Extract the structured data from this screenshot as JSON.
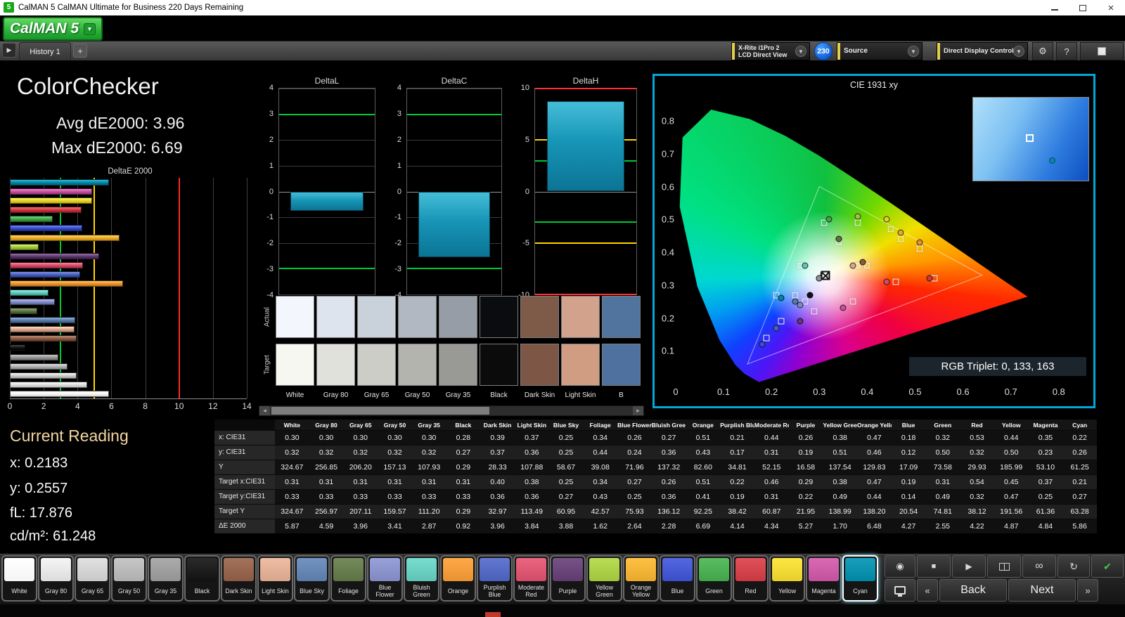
{
  "window": {
    "titlebar_icon": "5",
    "title": "CalMAN 5 CalMAN Ultimate for Business 220 Days Remaining",
    "logo_text": "CalMAN 5"
  },
  "tab_bar": {
    "tab": "History 1",
    "add_tab": "+"
  },
  "top_controls": {
    "meter_line1": "X-Rite i1Pro 2",
    "meter_line2": "LCD Direct View",
    "badge": "230",
    "source_label": "Source",
    "display_control_label": "Direct Display Control",
    "help_label": "?"
  },
  "summary": {
    "title": "ColorChecker",
    "avg_label": "Avg dE2000: 3.96",
    "max_label": "Max dE2000: 6.69"
  },
  "current_reading": {
    "title": "Current Reading",
    "x": "x: 0.2183",
    "y": "y: 0.2557",
    "fl": "fL: 17.876",
    "cd": "cd/m²: 61.248"
  },
  "cie_panel": {
    "title": "CIE 1931 xy",
    "rgb_triplet": "RGB Triplet: 0, 133, 163"
  },
  "swatch_compare": {
    "row_labels": [
      "Actual",
      "Target"
    ],
    "labels": [
      "White",
      "Gray 80",
      "Gray 65",
      "Gray 50",
      "Gray 35",
      "Black",
      "Dark Skin",
      "Light Skin",
      "B"
    ],
    "actual_colors": [
      "#f3f7fd",
      "#dde4ee",
      "#c9d1db",
      "#b1b8c1",
      "#979da7",
      "#0b0c10",
      "#7e5a49",
      "#d3a28c",
      "#51749f"
    ],
    "target_colors": [
      "#f7f7f2",
      "#e1e1dc",
      "#cdcdc8",
      "#b4b4af",
      "#999995",
      "#0b0b0b",
      "#7d5646",
      "#d09d83",
      "#4e71a0"
    ]
  },
  "patch_buttons": {
    "selected": "Cyan"
  },
  "nav": {
    "back": "Back",
    "next": "Next"
  },
  "chart_data": [
    {
      "type": "bar",
      "title": "DeltaE 2000",
      "orientation": "horizontal",
      "note": "bars drawn top-to-bottom from Cyan down to White",
      "categories": [
        "White",
        "Gray 80",
        "Gray 65",
        "Gray 50",
        "Gray 35",
        "Black",
        "Dark Skin",
        "Light Skin",
        "Blue Sky",
        "Foliage",
        "Blue Flower",
        "Bluish Green",
        "Orange",
        "Purplish Blue",
        "Moderate Red",
        "Purple",
        "Yellow Green",
        "Orange Yellow",
        "Blue",
        "Green",
        "Red",
        "Yellow",
        "Magenta",
        "Cyan"
      ],
      "values": [
        5.87,
        4.59,
        3.96,
        3.41,
        2.87,
        0.92,
        3.96,
        3.84,
        3.88,
        1.62,
        2.64,
        2.28,
        6.69,
        4.14,
        4.34,
        5.27,
        1.7,
        6.48,
        4.27,
        2.55,
        4.22,
        4.87,
        4.84,
        5.86
      ],
      "bar_colors": [
        "#f5f5f5",
        "#dcdcdc",
        "#c8c8c8",
        "#aeaeae",
        "#939393",
        "#121212",
        "#8a5a42",
        "#d7a58c",
        "#5a7ba8",
        "#5d7243",
        "#8088c2",
        "#5fc3b5",
        "#e89130",
        "#4a5fb8",
        "#d24c68",
        "#5e3a6e",
        "#a0c43c",
        "#e8a82c",
        "#3a4ec8",
        "#41a449",
        "#c83840",
        "#e8ce2a",
        "#c2519c",
        "#0085a3"
      ],
      "xlim": [
        0,
        14
      ],
      "x_ticks": [
        0,
        2,
        4,
        6,
        8,
        10,
        12,
        14
      ],
      "reference_lines": [
        {
          "value": 3,
          "color": "#00c832"
        },
        {
          "value": 5,
          "color": "#ffd400"
        },
        {
          "value": 10,
          "color": "#ff2828"
        }
      ]
    },
    {
      "type": "bar",
      "title": "DeltaL",
      "values": [
        -0.74
      ],
      "ylim": [
        -4,
        4
      ],
      "y_ticks": [
        4,
        3,
        2,
        1,
        0,
        -1,
        -2,
        -3,
        -4
      ],
      "reference_lines": [
        {
          "value": 3,
          "color": "#00c832"
        },
        {
          "value": -3,
          "color": "#00c832"
        }
      ]
    },
    {
      "type": "bar",
      "title": "DeltaC",
      "values": [
        -2.54
      ],
      "ylim": [
        -4,
        4
      ],
      "y_ticks": [
        4,
        3,
        2,
        1,
        0,
        -1,
        -2,
        -3,
        -4
      ],
      "reference_lines": [
        {
          "value": 3,
          "color": "#00c832"
        },
        {
          "value": -3,
          "color": "#00c832"
        }
      ]
    },
    {
      "type": "bar",
      "title": "DeltaH",
      "values": [
        8.8
      ],
      "ylim": [
        -10,
        10
      ],
      "y_ticks": [
        10,
        5,
        0,
        -5,
        -10
      ],
      "reference_lines": [
        {
          "value": 3,
          "color": "#00c832"
        },
        {
          "value": -3,
          "color": "#00c832"
        },
        {
          "value": 5,
          "color": "#ffd400"
        },
        {
          "value": -5,
          "color": "#ffd400"
        },
        {
          "value": 10,
          "color": "#ff3030"
        },
        {
          "value": -10,
          "color": "#ff3030"
        }
      ]
    },
    {
      "type": "scatter",
      "title": "CIE 1931 xy",
      "xlim": [
        0,
        0.84
      ],
      "ylim": [
        0,
        0.86
      ],
      "x_ticks": [
        "0",
        "0.1",
        "0.2",
        "0.3",
        "0.4",
        "0.5",
        "0.6",
        "0.7",
        "0.8"
      ],
      "y_ticks": [
        "0.1",
        "0.2",
        "0.3",
        "0.4",
        "0.5",
        "0.6",
        "0.7",
        "0.8"
      ],
      "white_point": {
        "x": 0.3127,
        "y": 0.329
      },
      "gamut_triangle": [
        [
          0.64,
          0.33
        ],
        [
          0.3,
          0.6
        ],
        [
          0.15,
          0.06
        ]
      ],
      "series": [
        {
          "name": "Target",
          "marker": "square",
          "points": [
            [
              0.31,
              0.33
            ],
            [
              0.31,
              0.33
            ],
            [
              0.31,
              0.33
            ],
            [
              0.31,
              0.33
            ],
            [
              0.31,
              0.33
            ],
            [
              0.31,
              0.33
            ],
            [
              0.4,
              0.36
            ],
            [
              0.38,
              0.36
            ],
            [
              0.25,
              0.27
            ],
            [
              0.34,
              0.43
            ],
            [
              0.27,
              0.25
            ],
            [
              0.26,
              0.36
            ],
            [
              0.51,
              0.41
            ],
            [
              0.22,
              0.19
            ],
            [
              0.46,
              0.31
            ],
            [
              0.29,
              0.22
            ],
            [
              0.38,
              0.49
            ],
            [
              0.47,
              0.44
            ],
            [
              0.19,
              0.14
            ],
            [
              0.31,
              0.49
            ],
            [
              0.54,
              0.32
            ],
            [
              0.45,
              0.47
            ],
            [
              0.37,
              0.25
            ],
            [
              0.21,
              0.27
            ]
          ]
        },
        {
          "name": "Measured",
          "marker": "circle",
          "points": [
            [
              0.3,
              0.32
            ],
            [
              0.3,
              0.32
            ],
            [
              0.3,
              0.32
            ],
            [
              0.3,
              0.32
            ],
            [
              0.3,
              0.32
            ],
            [
              0.28,
              0.27
            ],
            [
              0.39,
              0.37
            ],
            [
              0.37,
              0.36
            ],
            [
              0.25,
              0.25
            ],
            [
              0.34,
              0.44
            ],
            [
              0.26,
              0.24
            ],
            [
              0.27,
              0.36
            ],
            [
              0.51,
              0.43
            ],
            [
              0.21,
              0.17
            ],
            [
              0.44,
              0.31
            ],
            [
              0.26,
              0.19
            ],
            [
              0.38,
              0.51
            ],
            [
              0.47,
              0.46
            ],
            [
              0.18,
              0.12
            ],
            [
              0.32,
              0.5
            ],
            [
              0.53,
              0.32
            ],
            [
              0.44,
              0.5
            ],
            [
              0.35,
              0.23
            ],
            [
              0.22,
              0.26
            ]
          ]
        }
      ]
    },
    {
      "type": "table",
      "headers": [
        "White",
        "Gray 80",
        "Gray 65",
        "Gray 50",
        "Gray 35",
        "Black",
        "Dark Skin",
        "Light Skin",
        "Blue Sky",
        "Foliage",
        "Blue Flower",
        "Bluish Green",
        "Orange",
        "Purplish Blue",
        "Moderate Red",
        "Purple",
        "Yellow Green",
        "Orange Yellow",
        "Blue",
        "Green",
        "Red",
        "Yellow",
        "Magenta",
        "Cyan"
      ],
      "row_labels": [
        "x: CIE31",
        "y: CIE31",
        "Y",
        "Target x:CIE31",
        "Target y:CIE31",
        "Target Y",
        "ΔE 2000"
      ],
      "rows": [
        [
          "0.30",
          "0.30",
          "0.30",
          "0.30",
          "0.30",
          "0.28",
          "0.39",
          "0.37",
          "0.25",
          "0.34",
          "0.26",
          "0.27",
          "0.51",
          "0.21",
          "0.44",
          "0.26",
          "0.38",
          "0.47",
          "0.18",
          "0.32",
          "0.53",
          "0.44",
          "0.35",
          "0.22"
        ],
        [
          "0.32",
          "0.32",
          "0.32",
          "0.32",
          "0.32",
          "0.27",
          "0.37",
          "0.36",
          "0.25",
          "0.44",
          "0.24",
          "0.36",
          "0.43",
          "0.17",
          "0.31",
          "0.19",
          "0.51",
          "0.46",
          "0.12",
          "0.50",
          "0.32",
          "0.50",
          "0.23",
          "0.26"
        ],
        [
          "324.67",
          "256.85",
          "206.20",
          "157.13",
          "107.93",
          "0.29",
          "28.33",
          "107.88",
          "58.67",
          "39.08",
          "71.96",
          "137.32",
          "82.60",
          "34.81",
          "52.15",
          "16.58",
          "137.54",
          "129.83",
          "17.09",
          "73.58",
          "29.93",
          "185.99",
          "53.10",
          "61.25"
        ],
        [
          "0.31",
          "0.31",
          "0.31",
          "0.31",
          "0.31",
          "0.31",
          "0.40",
          "0.38",
          "0.25",
          "0.34",
          "0.27",
          "0.26",
          "0.51",
          "0.22",
          "0.46",
          "0.29",
          "0.38",
          "0.47",
          "0.19",
          "0.31",
          "0.54",
          "0.45",
          "0.37",
          "0.21"
        ],
        [
          "0.33",
          "0.33",
          "0.33",
          "0.33",
          "0.33",
          "0.33",
          "0.36",
          "0.36",
          "0.27",
          "0.43",
          "0.25",
          "0.36",
          "0.41",
          "0.19",
          "0.31",
          "0.22",
          "0.49",
          "0.44",
          "0.14",
          "0.49",
          "0.32",
          "0.47",
          "0.25",
          "0.27"
        ],
        [
          "324.67",
          "256.97",
          "207.11",
          "159.57",
          "111.20",
          "0.29",
          "32.97",
          "113.49",
          "60.95",
          "42.57",
          "75.93",
          "136.12",
          "92.25",
          "38.42",
          "60.87",
          "21.95",
          "138.99",
          "138.20",
          "20.54",
          "74.81",
          "38.12",
          "191.56",
          "61.36",
          "63.28"
        ],
        [
          "5.87",
          "4.59",
          "3.96",
          "3.41",
          "2.87",
          "0.92",
          "3.96",
          "3.84",
          "3.88",
          "1.62",
          "2.64",
          "2.28",
          "6.69",
          "4.14",
          "4.34",
          "5.27",
          "1.70",
          "6.48",
          "4.27",
          "2.55",
          "4.22",
          "4.87",
          "4.84",
          "5.86"
        ]
      ]
    }
  ]
}
